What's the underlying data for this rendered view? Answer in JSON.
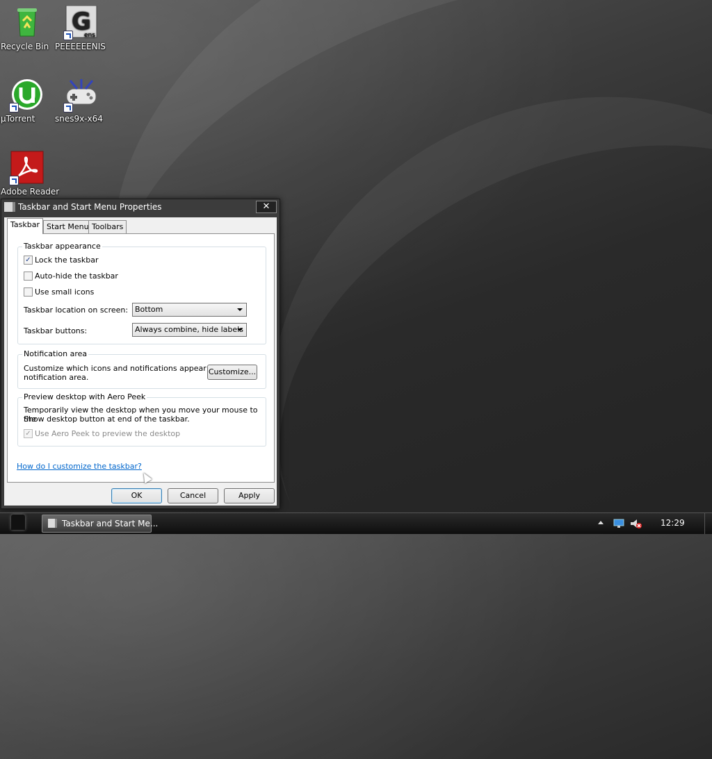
{
  "desktop": {
    "icons": [
      {
        "label": "Recycle Bin"
      },
      {
        "label": "PEEEEEENIS"
      },
      {
        "label": "µTorrent"
      },
      {
        "label": "snes9x-x64"
      },
      {
        "label": "Adobe Reader"
      }
    ]
  },
  "dialog": {
    "title": "Taskbar and Start Menu Properties",
    "close_label": "✕",
    "tabs": [
      "Taskbar",
      "Start Menu",
      "Toolbars"
    ],
    "appearance": {
      "title": "Taskbar appearance",
      "lock_label": "Lock the taskbar",
      "lock_checked": true,
      "autohide_label": "Auto-hide the taskbar",
      "autohide_checked": false,
      "small_icons_label": "Use small icons",
      "small_icons_checked": false,
      "location_label": "Taskbar location on screen:",
      "location_value": "Bottom",
      "buttons_label": "Taskbar buttons:",
      "buttons_value": "Always combine, hide labels"
    },
    "notification": {
      "title": "Notification area",
      "text_line1": "Customize which icons and notifications appear in the",
      "text_line2": "notification area.",
      "customize_label": "Customize..."
    },
    "aero": {
      "title": "Preview desktop with Aero Peek",
      "text_line1": "Temporarily view the desktop when you move your mouse to the",
      "text_line2": "Show desktop button at end of the taskbar.",
      "peek_label": "Use Aero Peek to preview the desktop",
      "peek_checked": true
    },
    "help_link": "How do I customize the taskbar?",
    "ok_label": "OK",
    "cancel_label": "Cancel",
    "apply_label": "Apply"
  },
  "taskbar": {
    "task_label": "Taskbar and Start Me...",
    "clock": "12:29"
  },
  "colors": {
    "link": "#0066cc",
    "utorrent_green": "#2aa82a",
    "adobe_red": "#c41a1a"
  }
}
